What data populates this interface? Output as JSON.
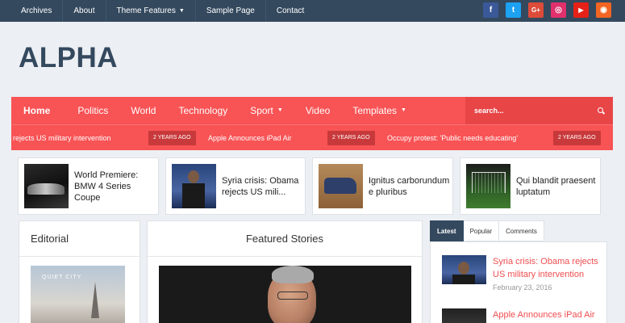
{
  "topnav": [
    {
      "label": "Archives",
      "caret": false
    },
    {
      "label": "About",
      "caret": false
    },
    {
      "label": "Theme Features",
      "caret": true
    },
    {
      "label": "Sample Page",
      "caret": false
    },
    {
      "label": "Contact",
      "caret": false
    }
  ],
  "social": [
    {
      "name": "facebook-icon",
      "glyph": "f",
      "color": "#3b5998"
    },
    {
      "name": "twitter-icon",
      "glyph": "t",
      "color": "#1da1f2"
    },
    {
      "name": "google-plus-icon",
      "glyph": "G+",
      "color": "#dd4b39"
    },
    {
      "name": "instagram-icon",
      "glyph": "◎",
      "color": "#e1306c"
    },
    {
      "name": "youtube-icon",
      "glyph": "▶",
      "color": "#e62117"
    },
    {
      "name": "rss-icon",
      "glyph": "◉",
      "color": "#f26522"
    }
  ],
  "logo": "ALPHA",
  "mainnav": [
    {
      "label": "Home",
      "caret": false
    },
    {
      "label": "Politics",
      "caret": false
    },
    {
      "label": "World",
      "caret": false
    },
    {
      "label": "Technology",
      "caret": false
    },
    {
      "label": "Sport",
      "caret": true
    },
    {
      "label": "Video",
      "caret": false
    },
    {
      "label": "Templates",
      "caret": true
    }
  ],
  "search": {
    "placeholder": "search..."
  },
  "ticker": [
    {
      "text": "rejects US military intervention",
      "badge": "2 YEARS AGO"
    },
    {
      "text": "Apple Announces iPad Air",
      "badge": "2 YEARS AGO"
    },
    {
      "text": "Occupy protest: 'Public needs educating'",
      "badge": "2 YEARS AGO"
    }
  ],
  "cards": [
    {
      "title": "World Premiere: BMW 4 Series Coupe"
    },
    {
      "title": "Syria crisis: Obama rejects US mili..."
    },
    {
      "title": "Ignitus carborundum e pluribus"
    },
    {
      "title": "Qui blandit praesent luptatum"
    }
  ],
  "editorial": {
    "title": "Editorial",
    "image_text": "QUIET CITY"
  },
  "featured": {
    "title": "Featured Stories"
  },
  "tabs": [
    {
      "label": "Latest",
      "active": true
    },
    {
      "label": "Popular",
      "active": false
    },
    {
      "label": "Comments",
      "active": false
    }
  ],
  "sidebar": [
    {
      "title": "Syria crisis: Obama rejects US military intervention",
      "date": "February 23, 2016"
    },
    {
      "title": "Apple Announces iPad Air",
      "date": ""
    }
  ]
}
